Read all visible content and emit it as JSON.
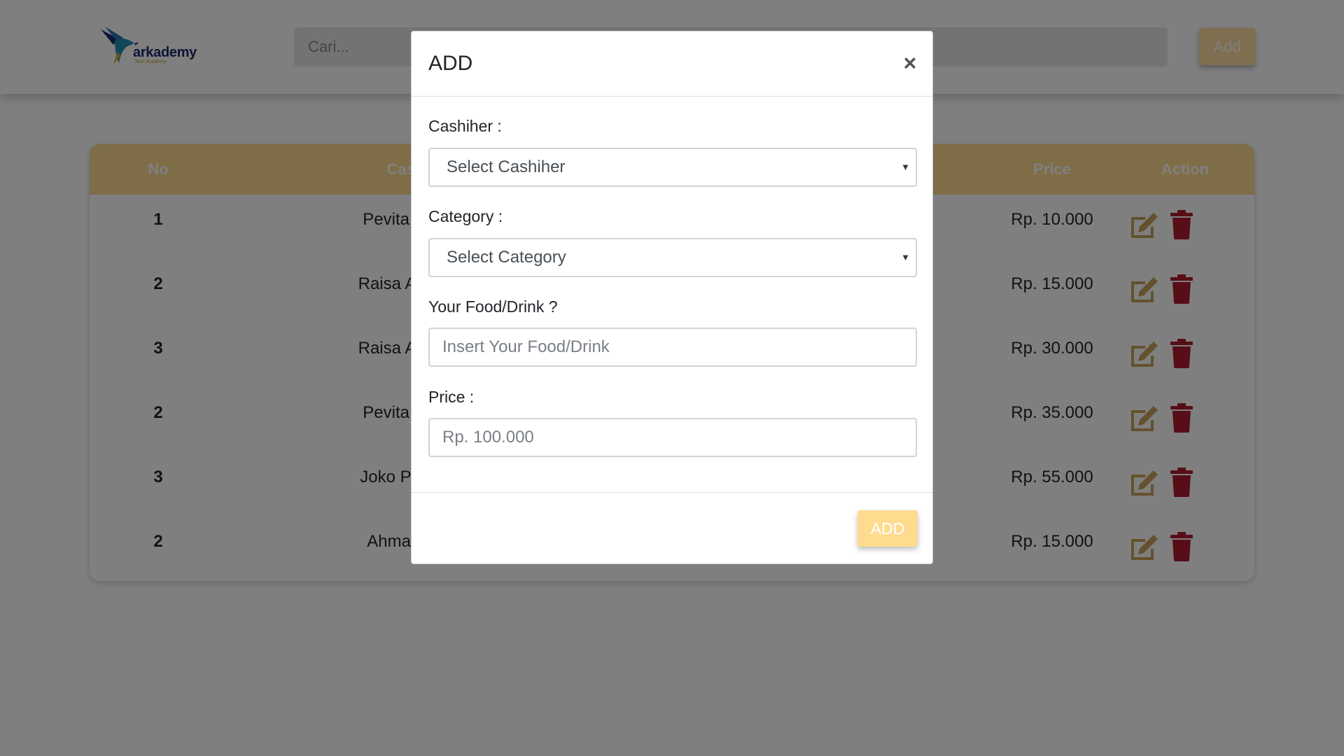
{
  "header": {
    "logo_text": "arkademy",
    "logo_sub": "Tech Academy",
    "search_placeholder": "Cari...",
    "add_label": "Add"
  },
  "table": {
    "columns": [
      "No",
      "Cashier",
      "Price",
      "Action"
    ],
    "rows": [
      {
        "no": "1",
        "cashier": "Pevita Pearce",
        "price": "Rp. 10.000"
      },
      {
        "no": "2",
        "cashier": "Raisa Andriana",
        "price": "Rp. 15.000"
      },
      {
        "no": "3",
        "cashier": "Raisa Andriana",
        "price": "Rp. 30.000"
      },
      {
        "no": "2",
        "cashier": "Pevita Pearce",
        "price": "Rp. 35.000"
      },
      {
        "no": "3",
        "cashier": "Joko Purwadhi",
        "price": "Rp. 55.000"
      },
      {
        "no": "2",
        "cashier": "Ahmad Nabil",
        "price": "Rp. 15.000"
      }
    ],
    "action_icons": [
      "edit-icon",
      "trash-icon"
    ]
  },
  "modal": {
    "title": "ADD",
    "close_label": "×",
    "cashier_label": "Cashiher :",
    "cashier_select": "Select Cashiher",
    "category_label": "Category :",
    "category_select": "Select Category",
    "food_label": "Your Food/Drink ?",
    "food_placeholder": "Insert Your Food/Drink",
    "price_label": "Price :",
    "price_placeholder": "Rp. 100.000",
    "submit_label": "ADD"
  },
  "colors": {
    "accent": "#fedb8f",
    "edit_icon": "#c9a35a",
    "trash_icon": "#b01c2e",
    "overlay": "rgba(0,0,0,0.5)"
  }
}
